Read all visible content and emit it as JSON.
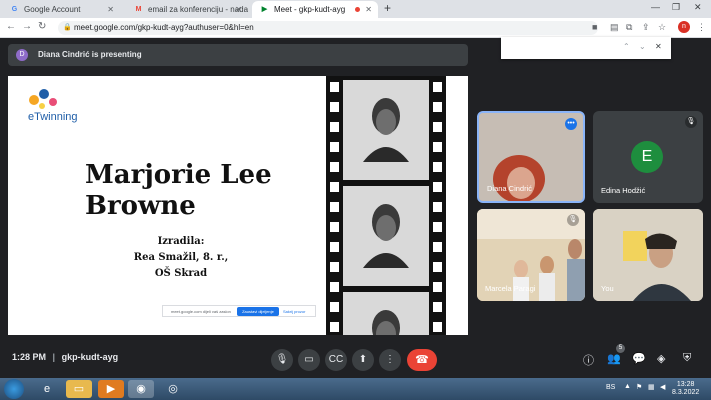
{
  "browser": {
    "tabs": [
      {
        "title": "Google Account",
        "favicon": "G"
      },
      {
        "title": "email za konferenciju - nadamin",
        "favicon": "M"
      },
      {
        "title": "Meet - gkp-kudt-ayg",
        "favicon": "▶"
      }
    ],
    "url": "meet.google.com/gkp-kudt-ayg?authuser=0&hl=en",
    "profile_initial": "n"
  },
  "meet": {
    "presenting_initial": "D",
    "presenting_text": "Diana Cindrić is presenting",
    "slide": {
      "logo_text": "eTwinning",
      "title_line1": "Marjorie Lee",
      "title_line2": "Browne",
      "author_line1": "Izradila:",
      "author_line2": "Rea Smažil, 8. r.,",
      "author_line3": "OŠ Skrad",
      "share_notice": "meet.google.com dijeli vaš zaslon",
      "share_stop": "Zaustavi dijeljenje",
      "share_hide": "Sakrij prozor"
    },
    "participants": [
      {
        "name": "Diana Cindrić"
      },
      {
        "name": "Edina Hodžić",
        "initial": "E"
      },
      {
        "name": "Marcela Paragi"
      },
      {
        "name": "You"
      }
    ],
    "time": "1:28 PM",
    "separator": "|",
    "meeting_code": "gkp-kudt-ayg",
    "people_count": "5"
  },
  "taskbar": {
    "language": "BS",
    "clock_time": "13:28",
    "clock_date": "8.3.2022"
  },
  "colors": {
    "meet_bg": "#202124",
    "end_call": "#ea4335",
    "active_tile_border": "#8ab4f8",
    "avatar_green": "#1e8e3e"
  }
}
